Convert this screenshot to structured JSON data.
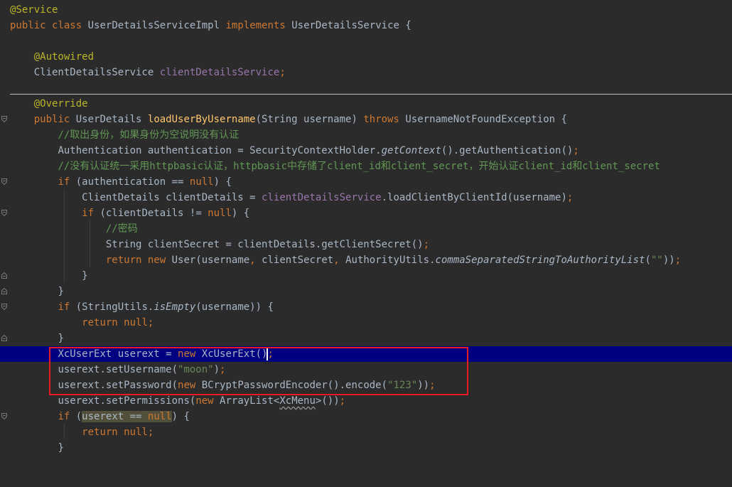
{
  "colors": {
    "background": "#2b2b2b",
    "keyword": "#cc7832",
    "annotation": "#bbb529",
    "method": "#ffc66d",
    "field": "#9876aa",
    "comment": "#629755",
    "string": "#6a8759",
    "default_text": "#a9b7c6",
    "current_line": "#000080",
    "red_box": "#e81b23"
  },
  "icons": [
    "fold-marker-icon"
  ],
  "code": {
    "l1_annotation": "@Service",
    "l2_public": "public",
    "l2_class": "class",
    "l2_name": "UserDetailsServiceImpl",
    "l2_implements": "implements",
    "l2_rest": "UserDetailsService {",
    "l4_annotation": "@Autowired",
    "l5_type": "ClientDetailsService",
    "l5_field": "clientDetailsService",
    "l5_semi": ";",
    "l7_annotation": "@Override",
    "l8_public": "public",
    "l8_type": "UserDetails",
    "l8_method": "loadUserByUsername",
    "l8_params": "(String username)",
    "l8_throws": "throws",
    "l8_rest": "UsernameNotFoundException {",
    "l9_comment": "//取出身份，如果身份为空说明没有认证",
    "l10_a": "Authentication authentication = SecurityContextHolder.",
    "l10_i": "getContext",
    "l10_b": "().getAuthentication()",
    "l10_semi": ";",
    "l11_comment": "//没有认证统一采用httpbasic认证，httpbasic中存储了client_id和client_secret，开始认证client_id和client_secret",
    "l12_if": "if",
    "l12_a": "(authentication ==",
    "l12_null": "null",
    "l12_b": ") {",
    "l13_a": "ClientDetails clientDetails =",
    "l13_field": "clientDetailsService",
    "l13_b": ".loadClientByClientId(username)",
    "l13_semi": ";",
    "l14_if": "if",
    "l14_a": "(clientDetails !=",
    "l14_null": "null",
    "l14_b": ") {",
    "l15_comment": "//密码",
    "l16_a": "String clientSecret = clientDetails.getClientSecret()",
    "l16_semi": ";",
    "l17_return": "return",
    "l17_new": "new",
    "l17_a": "User(username",
    "l17_comma1": ",",
    "l17_b": "clientSecret",
    "l17_comma2": ",",
    "l17_c": "AuthorityUtils.",
    "l17_i": "commaSeparatedStringToAuthorityList",
    "l17_d": "(",
    "l17_str": "\"\"",
    "l17_e": "))",
    "l17_semi": ";",
    "l18_brace": "}",
    "l19_brace": "}",
    "l20_if": "if",
    "l20_a": "(StringUtils.",
    "l20_i": "isEmpty",
    "l20_b": "(username)) {",
    "l21_return": "return",
    "l21_null": "null",
    "l21_semi": ";",
    "l22_brace": "}",
    "l23_a": "XcUserExt userext =",
    "l23_new": "new",
    "l23_b": "XcUserExt()",
    "l23_semi": ";",
    "l24_a": "userext.setUsername(",
    "l24_str": "\"moon\"",
    "l24_b": ")",
    "l24_semi": ";",
    "l25_a": "userext.setPassword(",
    "l25_new": "new",
    "l25_b": "BCryptPasswordEncoder().encode(",
    "l25_str": "\"123\"",
    "l25_c": "))",
    "l25_semi": ";",
    "l26_a": "userext.setPermissions(",
    "l26_new": "new",
    "l26_b": "ArrayList<",
    "l26_sq": "XcMenu",
    "l26_c": ">())",
    "l26_semi": ";",
    "l27_if": "if",
    "l27_a": "(",
    "l27_var": "userext ==",
    "l27_null": "null",
    "l27_b": ") {",
    "l28_return": "return",
    "l28_null": "null",
    "l28_semi": ";",
    "l29_brace": "}"
  }
}
